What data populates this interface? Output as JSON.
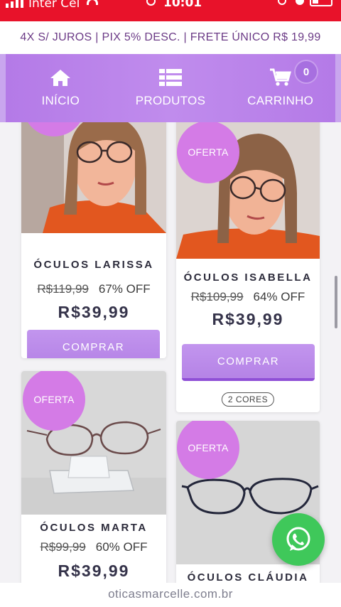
{
  "status_bar": {
    "carrier": "Inter Cel",
    "time": "10:01"
  },
  "promo_text": "4X S/ JUROS | PIX 5% DESC. | FRETE ÚNICO R$ 19,99",
  "nav": {
    "items": [
      {
        "label": "INÍCIO",
        "icon": "home-icon"
      },
      {
        "label": "PRODUTOS",
        "icon": "list-icon"
      },
      {
        "label": "CARRINHO",
        "icon": "cart-icon"
      }
    ],
    "cart_count": "0"
  },
  "products": [
    {
      "name": "ÓCULOS LARISSA",
      "old_price": "R$119,99",
      "discount": "67% OFF",
      "price": "R$39,99",
      "button": "COMPRAR"
    },
    {
      "badge": "OFERTA",
      "colors": "2 CORES",
      "name": "ÓCULOS ISABELLA",
      "old_price": "R$109,99",
      "discount": "64% OFF",
      "price": "R$39,99",
      "button": "COMPRAR"
    },
    {
      "badge": "OFERTA",
      "name": "ÓCULOS MARTA",
      "old_price": "R$99,99",
      "discount": "60% OFF",
      "price": "R$39,99"
    },
    {
      "badge": "OFERTA",
      "name": "ÓCULOS CLÁUDIA"
    }
  ],
  "url": "oticasmarcelle.com.br",
  "colors": {
    "accent": "#b47ae7",
    "badge": "#d47be6",
    "status_bar": "#e8122a",
    "whatsapp": "#3fc85a"
  }
}
